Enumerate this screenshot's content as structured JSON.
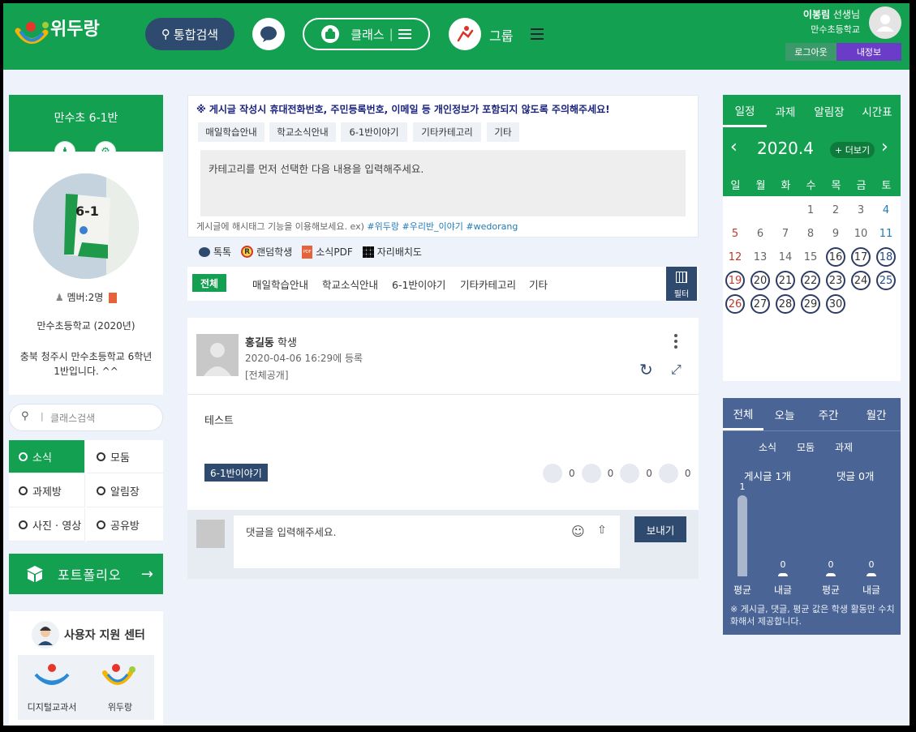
{
  "header": {
    "logo_text": "위두랑",
    "search_label": "통합검색",
    "class_label": "클래스",
    "group_label": "그룹",
    "user_name": "이봉림",
    "user_title": "선생님",
    "user_school": "만수초등학교",
    "logout_label": "로그아웃",
    "myinfo_label": "내정보"
  },
  "left": {
    "class_title": "만수초 6-1반",
    "member_label": "멤버:2명",
    "school_year": "만수초등학교 (2020년)",
    "class_desc_1": "충북 청주시 만수초등학교 6학년",
    "class_desc_2": "1반입니다. ^^",
    "search_placeholder": "클래스검색",
    "menu": [
      "소식",
      "모둠",
      "과제방",
      "알림장",
      "사진 · 영상",
      "공유방"
    ],
    "portfolio_label": "포트폴리오",
    "support_title": "사용자 지원 센터",
    "support_links": [
      "디지털교과서",
      "위두랑"
    ]
  },
  "writer": {
    "notice": "※ 게시글 작성시 휴대전화번호, 주민등록번호, 이메일 등 개인정보가 포함되지 않도록 주의해주세요!",
    "categories": [
      "매일학습안내",
      "학교소식안내",
      "6-1반이야기",
      "기타카테고리",
      "기타"
    ],
    "placeholder": "카테고리를 먼저 선택한 다음 내용을 입력해주세요.",
    "hashtag_tip": "게시글에 해시태그 기능을 이용해보세요. ex)",
    "hashtag_examples": "#위두랑 #우리반_이야기 #wedorang"
  },
  "tools": [
    "톡톡",
    "랜덤학생",
    "소식PDF",
    "자리배치도"
  ],
  "filter": {
    "tabs": [
      "전체",
      "매일학습안내",
      "학교소식안내",
      "6-1반이야기",
      "기타카테고리",
      "기타"
    ],
    "filter_label": "필터"
  },
  "post": {
    "author": "홍길동",
    "role": "학생",
    "date": "2020-04-06 16:29에 등록",
    "visibility": "[전체공개]",
    "content": "테스트",
    "category": "6-1반이야기",
    "counts": [
      "0",
      "0",
      "0",
      "0"
    ],
    "comment_placeholder": "댓글을 입력해주세요.",
    "send_label": "보내기"
  },
  "calendar": {
    "tabs": [
      "일정",
      "과제",
      "알림장",
      "시간표"
    ],
    "month": "2020.4",
    "more_label": "+ 더보기",
    "weekdays": [
      "일",
      "월",
      "화",
      "수",
      "목",
      "금",
      "토"
    ],
    "weeks": [
      [
        "",
        "",
        "",
        "1",
        "2",
        "3",
        "4"
      ],
      [
        "5",
        "6",
        "7",
        "8",
        "9",
        "10",
        "11"
      ],
      [
        "12",
        "13",
        "14",
        "15",
        "16",
        "17",
        "18"
      ],
      [
        "19",
        "20",
        "21",
        "22",
        "23",
        "24",
        "25"
      ],
      [
        "26",
        "27",
        "28",
        "29",
        "30",
        "",
        ""
      ]
    ]
  },
  "stats": {
    "tabs": [
      "전체",
      "오늘",
      "주간",
      "월간"
    ],
    "subtabs": [
      "소식",
      "모둠",
      "과제"
    ],
    "posts_label": "게시글 1개",
    "comments_label": "댓글 0개",
    "bars": [
      {
        "value": "1",
        "label": "평균"
      },
      {
        "value": "0",
        "label": "내글"
      },
      {
        "value": "0",
        "label": "평균"
      },
      {
        "value": "0",
        "label": "내글"
      }
    ],
    "note": "※ 게시글, 댓글, 평균 값은 학생 활동만 수치화해서 제공합니다."
  }
}
